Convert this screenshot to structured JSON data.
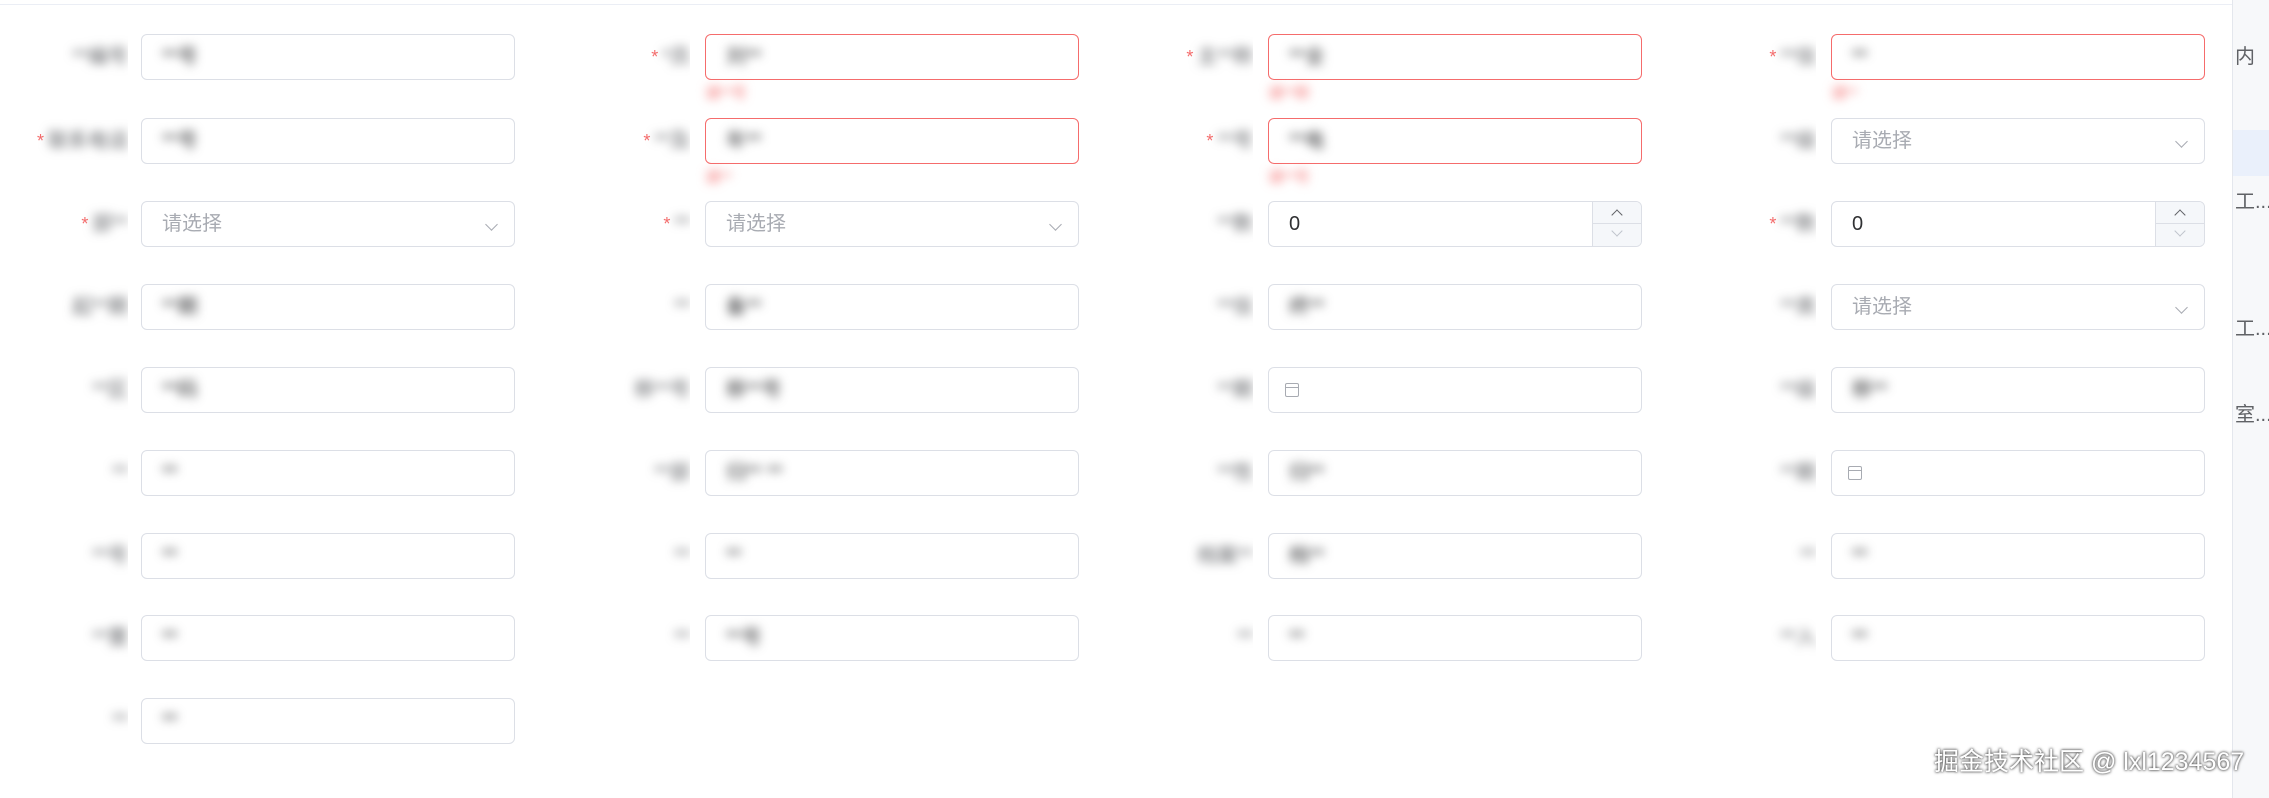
{
  "form": {
    "rows": [
      [
        {
          "label": "**编号",
          "required": false,
          "value": "**号",
          "placeholder": "",
          "type": "text"
        },
        {
          "label": "*员",
          "required": true,
          "value": "刘**",
          "placeholder": "",
          "type": "text",
          "error": true,
          "error_text": "请**号"
        },
        {
          "label": "主**称",
          "required": true,
          "value": "**全",
          "placeholder": "",
          "type": "text",
          "error": true,
          "error_text": "请**称"
        },
        {
          "label": "**信",
          "required": true,
          "value": "**",
          "placeholder": "",
          "type": "text",
          "error": true,
          "error_text": "请**"
        }
      ],
      [
        {
          "label": "联系电话",
          "required": true,
          "value": "**号",
          "placeholder": "",
          "type": "text"
        },
        {
          "label": "**及",
          "required": true,
          "value": "年**",
          "placeholder": "",
          "type": "text",
          "error": true,
          "error_text": "请**"
        },
        {
          "label": "**号",
          "required": true,
          "value": "**电",
          "placeholder": "",
          "type": "text",
          "error": true,
          "error_text": "请**号"
        },
        {
          "label": "**级",
          "required": false,
          "value": "",
          "placeholder": "请选择",
          "type": "select"
        }
      ],
      [
        {
          "label": "部**",
          "required": true,
          "value": "",
          "placeholder": "请选择",
          "type": "select"
        },
        {
          "label": "**",
          "required": true,
          "value": "",
          "placeholder": "请选择",
          "type": "select"
        },
        {
          "label": "**数",
          "required": false,
          "value": "0",
          "placeholder": "",
          "type": "number"
        },
        {
          "label": "**数",
          "required": true,
          "value": "0",
          "placeholder": "",
          "type": "number"
        }
      ],
      [
        {
          "label": "起**期",
          "required": false,
          "value": "**期",
          "placeholder": "",
          "type": "text"
        },
        {
          "label": "**",
          "required": false,
          "value": "备**",
          "placeholder": "",
          "type": "text"
        },
        {
          "label": "**信",
          "required": false,
          "value": "终**",
          "placeholder": "",
          "type": "text"
        },
        {
          "label": "**类",
          "required": false,
          "value": "",
          "placeholder": "请选择",
          "type": "select"
        }
      ],
      [
        {
          "label": "**区",
          "required": false,
          "value": "**码",
          "placeholder": "",
          "type": "text"
        },
        {
          "label": "移**号",
          "required": false,
          "value": "移**号",
          "placeholder": "",
          "type": "text"
        },
        {
          "label": "**期",
          "required": false,
          "value": "",
          "placeholder": "",
          "type": "date"
        },
        {
          "label": "**级",
          "required": false,
          "value": "移**",
          "placeholder": "",
          "type": "text"
        }
      ],
      [
        {
          "label": "**",
          "required": false,
          "value": "**",
          "placeholder": "",
          "type": "text"
        },
        {
          "label": "**部",
          "required": false,
          "value": "归** **",
          "placeholder": "",
          "type": "text"
        },
        {
          "label": "**性",
          "required": false,
          "value": "归**",
          "placeholder": "",
          "type": "text"
        },
        {
          "label": "**期",
          "required": false,
          "value": "",
          "placeholder": "",
          "type": "date"
        }
      ],
      [
        {
          "label": "**号",
          "required": false,
          "value": "**",
          "placeholder": "",
          "type": "text"
        },
        {
          "label": "**",
          "required": false,
          "value": "**",
          "placeholder": "",
          "type": "text"
        },
        {
          "label": "档案**",
          "required": false,
          "value": "档**",
          "placeholder": "",
          "type": "text"
        },
        {
          "label": "**",
          "required": false,
          "value": "**",
          "placeholder": "",
          "type": "text"
        }
      ],
      [
        {
          "label": "**置",
          "required": false,
          "value": "**",
          "placeholder": "",
          "type": "text"
        },
        {
          "label": "**",
          "required": false,
          "value": "**号",
          "placeholder": "",
          "type": "text"
        },
        {
          "label": "**",
          "required": false,
          "value": "**",
          "placeholder": "",
          "type": "text"
        },
        {
          "label": "**入",
          "required": false,
          "value": "**",
          "placeholder": "",
          "type": "text"
        }
      ],
      [
        {
          "label": "**",
          "required": false,
          "value": "**",
          "placeholder": "",
          "type": "text"
        }
      ]
    ]
  },
  "right_panel": {
    "items": [
      "内",
      "工...",
      "工...",
      "室..."
    ]
  },
  "watermark": "掘金技术社区 @ lxl1234567",
  "colors": {
    "border": "#dcdfe6",
    "error": "#f56c6c",
    "placeholder": "#a8abb2",
    "text": "#303133"
  }
}
